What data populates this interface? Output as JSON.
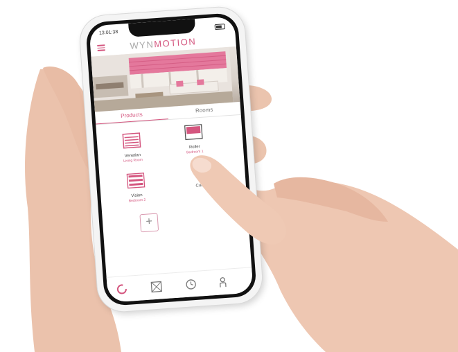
{
  "status_bar": {
    "time": "13:01:38"
  },
  "header": {
    "brand_prefix": "WYN",
    "brand_suffix": "MOTION",
    "menu_icon": "hamburger-menu-icon"
  },
  "tabs": [
    {
      "label": "Products",
      "active": true
    },
    {
      "label": "Rooms",
      "active": false
    }
  ],
  "products": [
    {
      "name": "Venetian",
      "room": "Living Room",
      "icon": "venetian-blind-icon"
    },
    {
      "name": "Roller",
      "room": "Bedroom 1",
      "icon": "roller-blind-icon"
    },
    {
      "name": "Vision",
      "room": "Bedroom 2",
      "icon": "vision-blind-icon"
    },
    {
      "name": "Curt...",
      "room": "",
      "icon": "curtain-icon"
    }
  ],
  "add_button_label": "+",
  "bottom_nav": [
    {
      "icon": "power-ring-icon",
      "active": true
    },
    {
      "icon": "window-blind-icon",
      "active": false
    },
    {
      "icon": "clock-icon",
      "active": false
    },
    {
      "icon": "user-icon",
      "active": false
    }
  ],
  "colors": {
    "accent": "#d4567f",
    "brand_gray": "#a9a9a9",
    "hero_blinds": "#e4789c"
  }
}
